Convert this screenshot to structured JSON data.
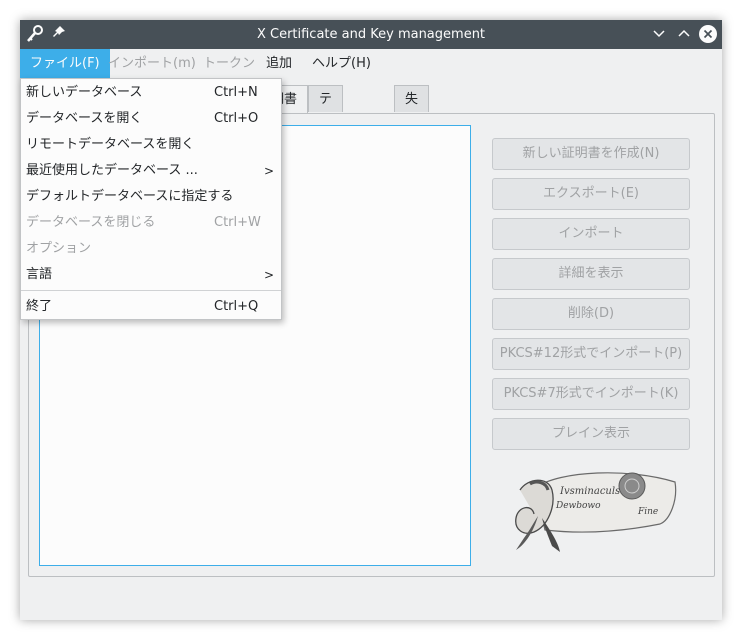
{
  "window": {
    "title": "X Certificate and Key management"
  },
  "titlebar_icons": {
    "app": "key-icon",
    "pin": "pin-icon",
    "minimize": "chevron-down-icon",
    "maximize": "chevron-up-icon",
    "close": "close-icon"
  },
  "menubar": {
    "file": "ファイル(F)",
    "import": "インポート(m)",
    "token": "トークン",
    "extra": "追加",
    "help": "ヘルプ(H)"
  },
  "tabs": {
    "certificates_partial": "明書",
    "templates": "テンプレート",
    "revocation": "失効リスト"
  },
  "file_menu": {
    "new_db": {
      "label": "新しいデータベース",
      "shortcut": "Ctrl+N"
    },
    "open_db": {
      "label": "データベースを開く",
      "shortcut": "Ctrl+O"
    },
    "open_remote": {
      "label": "リモートデータベースを開く"
    },
    "recent": {
      "label": "最近使用したデータベース ...",
      "arrow": ">"
    },
    "set_default": {
      "label": "デフォルトデータベースに指定する"
    },
    "close_db": {
      "label": "データベースを閉じる",
      "shortcut": "Ctrl+W"
    },
    "options": {
      "label": "オプション"
    },
    "language": {
      "label": "言語",
      "arrow": ">"
    },
    "quit": {
      "label": "終了",
      "shortcut": "Ctrl+Q"
    }
  },
  "buttons": {
    "new_cert": "新しい証明書を作成(N)",
    "export": "エクスポート(E)",
    "import": "インポート",
    "details": "詳細を表示",
    "delete": "削除(D)",
    "import_pkcs12": "PKCS#12形式でインポート(P)",
    "import_pkcs7": "PKCS#7形式でインポート(K)",
    "plain": "プレイン表示"
  },
  "logo": {
    "text_line1": "Ivsminaculs",
    "text_line2": "Dewbowo",
    "text_line3": "Fine"
  },
  "colors": {
    "accent": "#3daee9",
    "titlebar": "#475057",
    "window_bg": "#eff0f1"
  }
}
